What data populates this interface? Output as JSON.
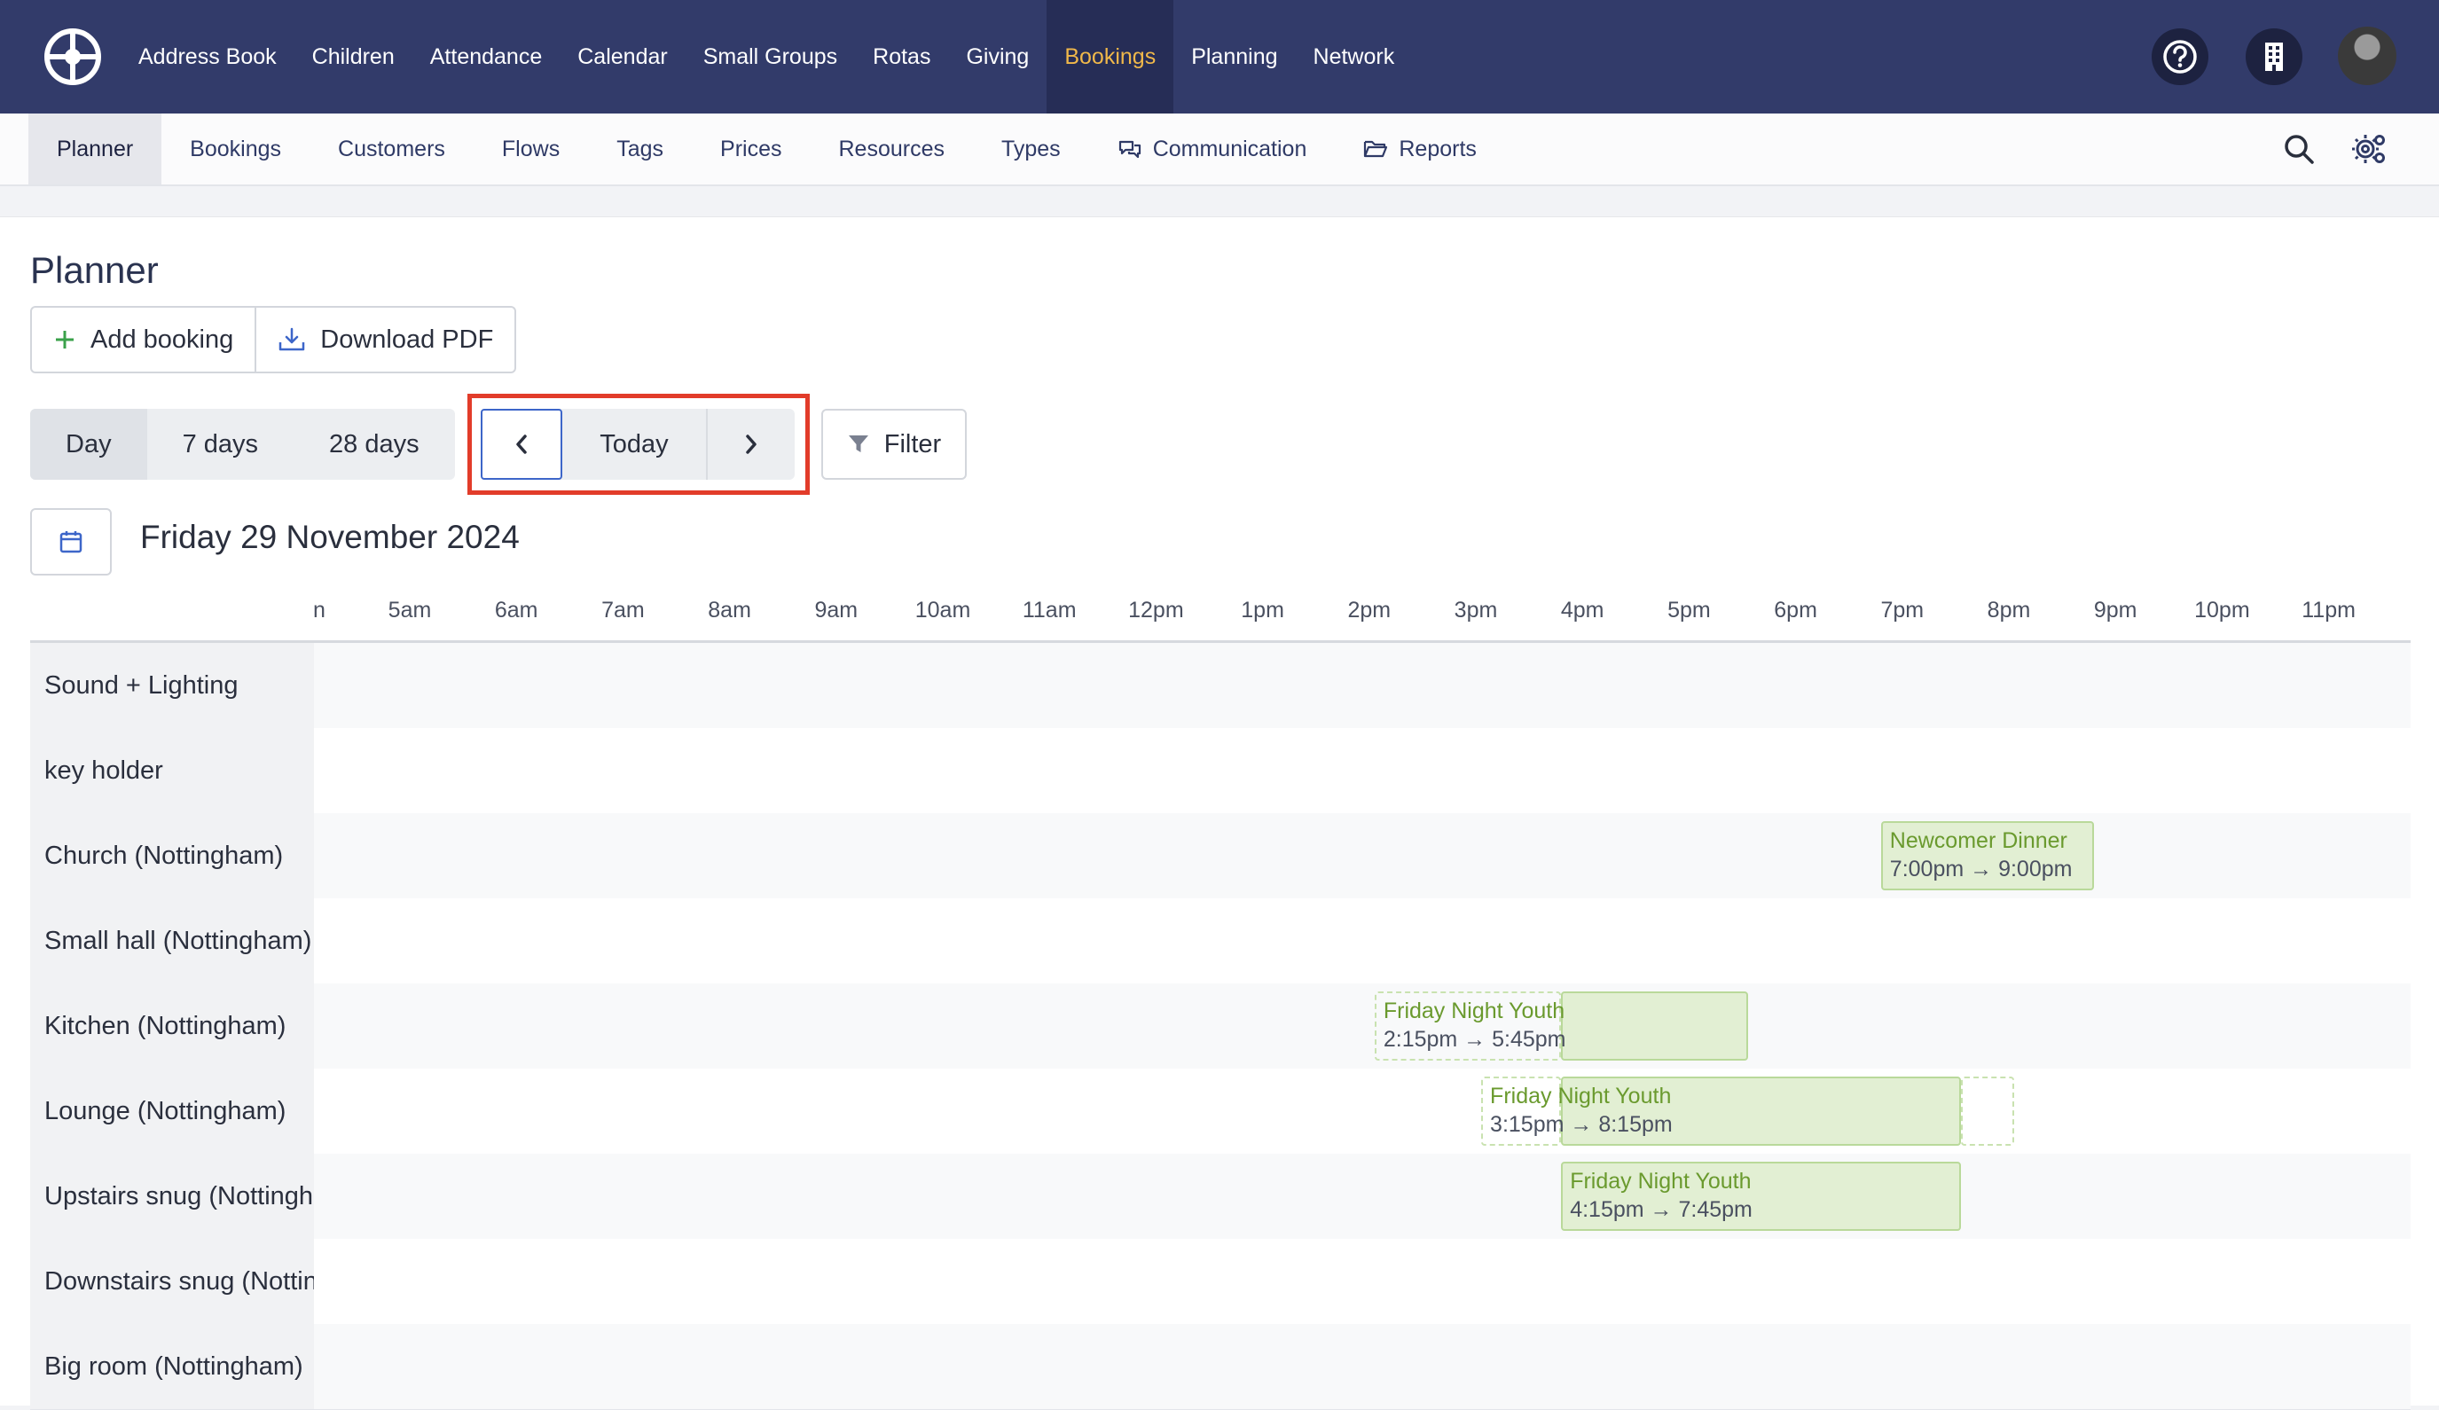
{
  "topnav": {
    "items": [
      "Address Book",
      "Children",
      "Attendance",
      "Calendar",
      "Small Groups",
      "Rotas",
      "Giving",
      "Bookings",
      "Planning",
      "Network"
    ],
    "active": "Bookings",
    "icons": [
      "help-circle-icon",
      "building-icon",
      "avatar"
    ]
  },
  "subnav": {
    "items": [
      {
        "label": "Planner",
        "icon": ""
      },
      {
        "label": "Bookings",
        "icon": ""
      },
      {
        "label": "Customers",
        "icon": ""
      },
      {
        "label": "Flows",
        "icon": ""
      },
      {
        "label": "Tags",
        "icon": ""
      },
      {
        "label": "Prices",
        "icon": ""
      },
      {
        "label": "Resources",
        "icon": ""
      },
      {
        "label": "Types",
        "icon": ""
      },
      {
        "label": "Communication",
        "icon": "chat-bubbles-icon"
      },
      {
        "label": "Reports",
        "icon": "folder-open-icon"
      }
    ],
    "active": "Planner",
    "right_icons": [
      "search-icon",
      "gear-settings-icon"
    ]
  },
  "page": {
    "title": "Planner",
    "add_booking": "Add booking",
    "download_pdf": "Download PDF",
    "views": [
      "Day",
      "7 days",
      "28 days"
    ],
    "active_view": "Day",
    "today": "Today",
    "prev_symbol": "‹",
    "next_symbol": "›",
    "filter": "Filter",
    "date": "Friday 29 November 2024"
  },
  "planner": {
    "hours": [
      "n",
      "5am",
      "6am",
      "7am",
      "8am",
      "9am",
      "10am",
      "11am",
      "12pm",
      "1pm",
      "2pm",
      "3pm",
      "4pm",
      "5pm",
      "6pm",
      "7pm",
      "8pm",
      "9pm",
      "10pm",
      "11pm"
    ],
    "resources": [
      "Sound + Lighting",
      "key holder",
      "Church (Nottingham)",
      "Small hall (Nottingham)",
      "Kitchen (Nottingham)",
      "Lounge (Nottingham)",
      "Upstairs snug (Nottingham)",
      "Downstairs snug (Nottingham)",
      "Big room (Nottingham)"
    ],
    "events": [
      {
        "resource": 2,
        "title": "Newcomer Dinner",
        "time": "7:00pm → 9:00pm",
        "start": 19.0,
        "end": 21.0
      },
      {
        "resource": 4,
        "title": "Friday Night Youth",
        "time": "2:15pm → 5:45pm",
        "start": 14.25,
        "end": 16.0,
        "ghost": true
      },
      {
        "resource": 4,
        "title": "",
        "time": "",
        "start": 16.0,
        "end": 17.75
      },
      {
        "resource": 5,
        "title": "Friday Night Youth",
        "time": "3:15pm → 8:15pm",
        "start": 15.25,
        "end": 16.0,
        "ghost": true
      },
      {
        "resource": 5,
        "title": "",
        "time": "",
        "start": 16.0,
        "end": 19.75
      },
      {
        "resource": 5,
        "title": "",
        "time": "",
        "start": 19.75,
        "end": 20.25,
        "ghost": true
      },
      {
        "resource": 6,
        "title": "Friday Night Youth",
        "time": "4:15pm → 7:45pm",
        "start": 16.0,
        "end": 19.75
      }
    ]
  }
}
